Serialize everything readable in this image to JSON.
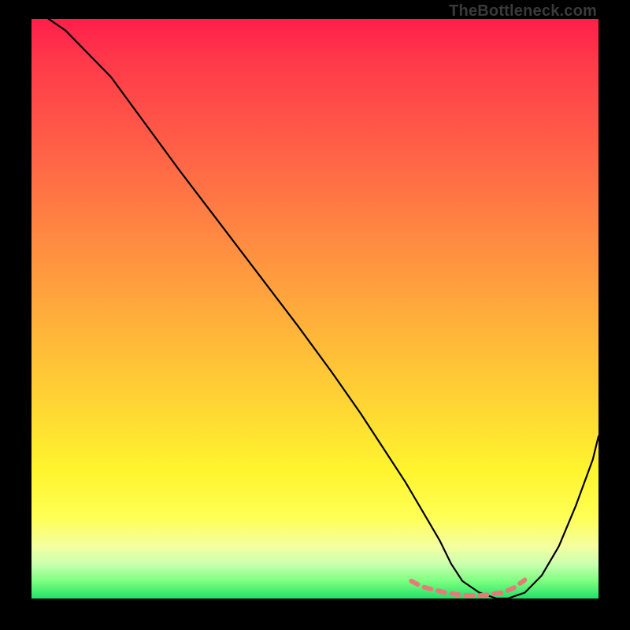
{
  "watermark": "TheBottleneck.com",
  "chart_data": {
    "type": "line",
    "title": "",
    "xlabel": "",
    "ylabel": "",
    "xlim": [
      0,
      100
    ],
    "ylim": [
      0,
      100
    ],
    "grid": false,
    "legend": false,
    "note": "Axes have no visible tick labels; x and y are normalized 0–100 based on position within the gradient plot area. The curve shows a steep descent from top-left to a flat minimum near the lower-right, then a rise toward the right edge.",
    "series": [
      {
        "name": "bottleneck-curve",
        "color": "#000000",
        "x": [
          3,
          6,
          9,
          14,
          20,
          26,
          33,
          40,
          47,
          53,
          58,
          62,
          66,
          69,
          72,
          74,
          76,
          79,
          82,
          84,
          87,
          90,
          93,
          96,
          99,
          100
        ],
        "y": [
          100,
          98,
          95,
          90,
          82,
          74,
          65,
          56,
          47,
          39,
          32,
          26,
          20,
          15,
          10,
          6,
          3,
          1,
          0,
          0,
          1,
          4,
          9,
          16,
          24,
          28
        ]
      }
    ],
    "markers": {
      "name": "bottom-dashed-segment",
      "color": "#e77a78",
      "description": "Short dashed salmon segment tracing the valley floor of the curve.",
      "x": [
        67,
        69,
        71,
        73,
        75,
        77,
        79,
        81,
        83,
        85,
        87
      ],
      "y": [
        3,
        2,
        1.5,
        1,
        0.7,
        0.5,
        0.5,
        0.7,
        1,
        1.8,
        3.2
      ]
    }
  }
}
